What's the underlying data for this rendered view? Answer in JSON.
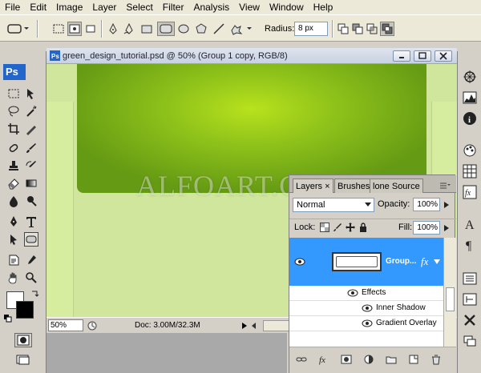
{
  "menu": [
    "File",
    "Edit",
    "Image",
    "Layer",
    "Select",
    "Filter",
    "Analysis",
    "View",
    "Window",
    "Help"
  ],
  "options": {
    "radius_label": "Radius:",
    "radius_value": "8 px"
  },
  "toolbox": {
    "logo": "Ps"
  },
  "document": {
    "title": "green_design_tutorial.psd @ 50% (Group 1 copy, RGB/8)",
    "watermark": "ALFOART.COM",
    "zoom": "50%",
    "doc_info": "Doc: 3.00M/32.3M"
  },
  "layers": {
    "tabs": [
      "Layers ×",
      "Brushes",
      "lone Source"
    ],
    "blend_mode": "Normal",
    "opacity_label": "Opacity:",
    "opacity": "100%",
    "lock_label": "Lock:",
    "fill_label": "Fill:",
    "fill": "100%",
    "layer_name": "Group...",
    "fx_label": "fx",
    "effects_label": "Effects",
    "effects": [
      "Inner Shadow",
      "Gradient Overlay"
    ]
  },
  "colors": {
    "selection": "#3399ff",
    "canvas_bg": "#cfe69c",
    "green_dark": "#659a14",
    "green_light": "#b8e21d"
  }
}
